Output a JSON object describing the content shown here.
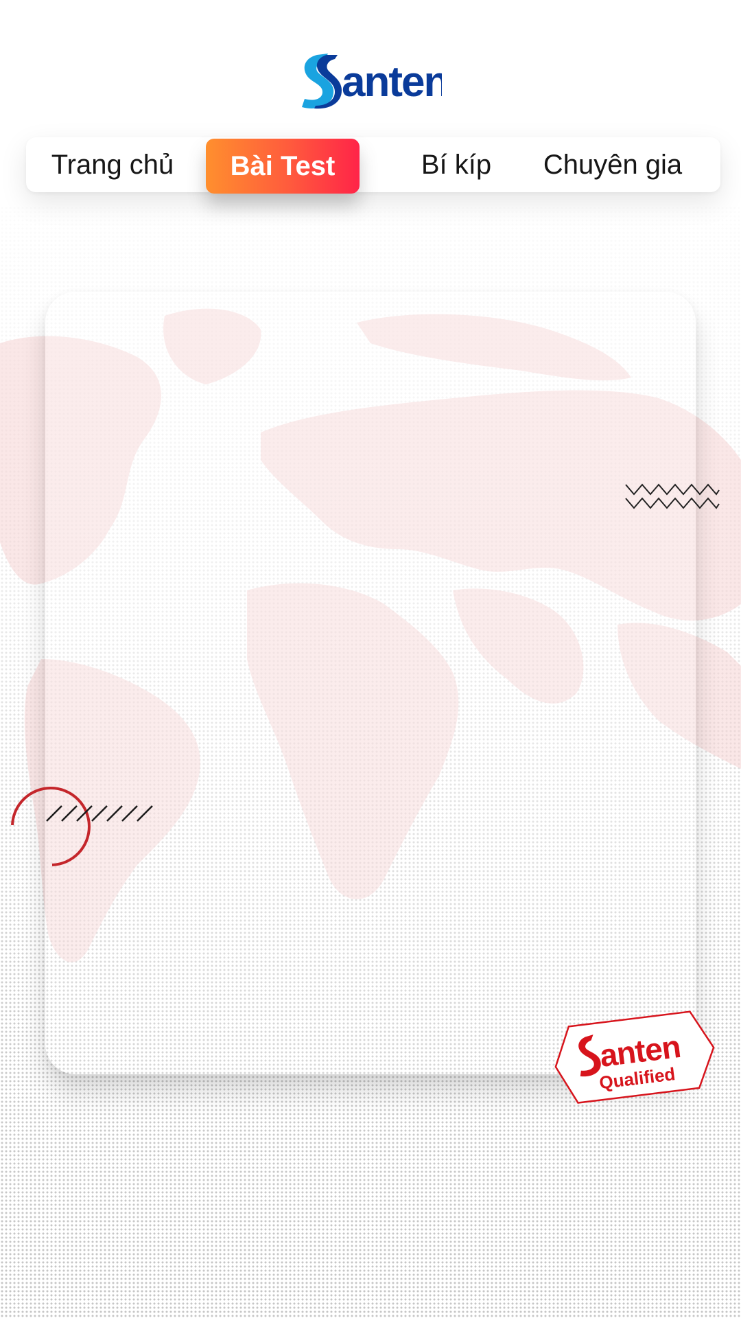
{
  "header": {
    "brand": "Santen"
  },
  "nav": {
    "tabs": [
      {
        "label": "Trang chủ",
        "active": false
      },
      {
        "label": "Bài Test",
        "active": true
      },
      {
        "label": "Bí kíp",
        "active": false
      },
      {
        "label": "Chuyên gia",
        "active": false
      }
    ]
  },
  "badge": {
    "brand": "Santen",
    "text": "Qualified"
  },
  "colors": {
    "brand_blue": "#0a3b9a",
    "brand_cyan": "#1aa3e0",
    "active_tab_start": "#ff8f2e",
    "active_tab_end": "#ff2448",
    "badge_red": "#d7141c",
    "map_tint": "#f3c9c9"
  }
}
